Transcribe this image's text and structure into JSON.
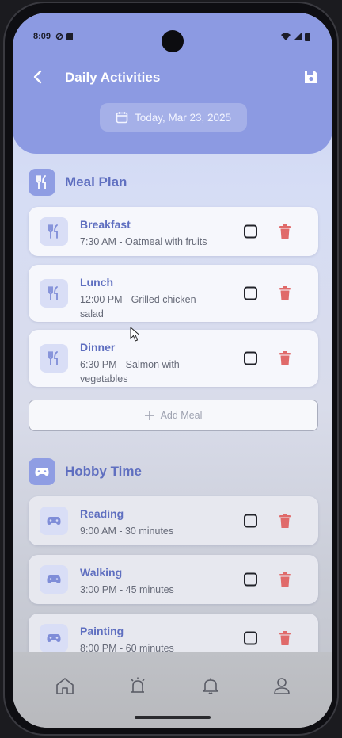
{
  "status_bar": {
    "time": "8:09"
  },
  "header": {
    "title": "Daily Activities",
    "date": "Today, Mar 23, 2025"
  },
  "meal_section": {
    "title": "Meal Plan",
    "items": [
      {
        "name": "Breakfast",
        "description": "7:30 AM - Oatmeal with fruits"
      },
      {
        "name": "Lunch",
        "description": "12:00 PM - Grilled chicken salad"
      },
      {
        "name": "Dinner",
        "description": "6:30 PM - Salmon with vegetables"
      }
    ],
    "add_label": "Add Meal"
  },
  "hobby_section": {
    "title": "Hobby Time",
    "items": [
      {
        "name": "Reading",
        "description": "9:00 AM - 30 minutes"
      },
      {
        "name": "Walking",
        "description": "3:00 PM - 45 minutes"
      },
      {
        "name": "Painting",
        "description": "8:00 PM - 60 minutes"
      }
    ]
  },
  "bottom_nav": [
    "home-icon",
    "alarm-icon",
    "bell-icon",
    "profile-icon"
  ],
  "colors": {
    "accent": "#8c9ae2",
    "accent_text": "#5f6fc0",
    "delete": "#e06a6a"
  }
}
